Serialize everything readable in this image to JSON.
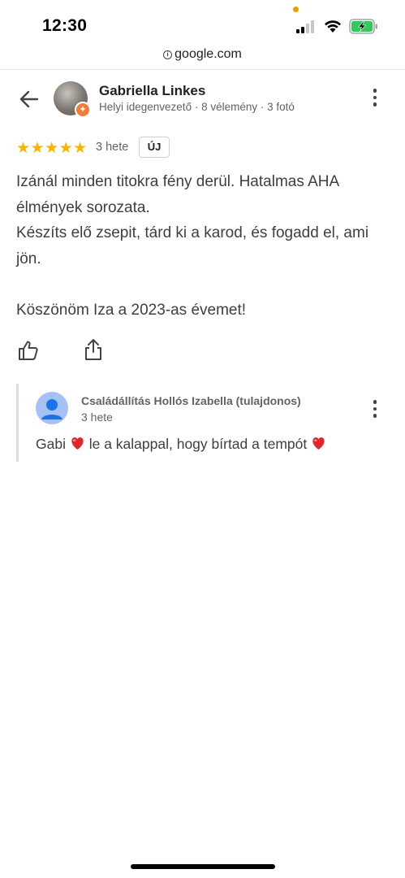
{
  "status_bar": {
    "time": "12:30"
  },
  "browser": {
    "url": "google.com"
  },
  "review": {
    "author": {
      "name": "Gabriella Linkes",
      "meta": "Helyi idegenvezető · 8 vélemény · 3 fotó"
    },
    "rating": 5,
    "rating_stars": "★★★★★",
    "time": "3 hete",
    "badge": "ÚJ",
    "text_lines": [
      "Izánál minden titokra fény derül. Hatalmas AHA élmények sorozata.",
      "Készíts elő zsepit, tárd ki a karod, és fogadd el, ami jön.",
      "Köszönöm Iza a 2023-as évemet!"
    ]
  },
  "owner_reply": {
    "name": "Családállítás Hollós Izabella (tulajdonos)",
    "time": "3 hete",
    "text_parts": [
      "Gabi",
      "le a kalappal, hogy bírtad a tempót"
    ]
  },
  "colors": {
    "star": "#f8b400",
    "local_guide": "#f37c3a",
    "heart": "#e0262b",
    "owner_avatar": "#a6c1f5",
    "battery_fill": "#34c759"
  },
  "icons": [
    "back-arrow-icon",
    "more-vert-icon",
    "thumbs-up-icon",
    "share-icon",
    "heart-icon",
    "info-icon",
    "signal-icon",
    "wifi-icon",
    "battery-charging-icon"
  ]
}
